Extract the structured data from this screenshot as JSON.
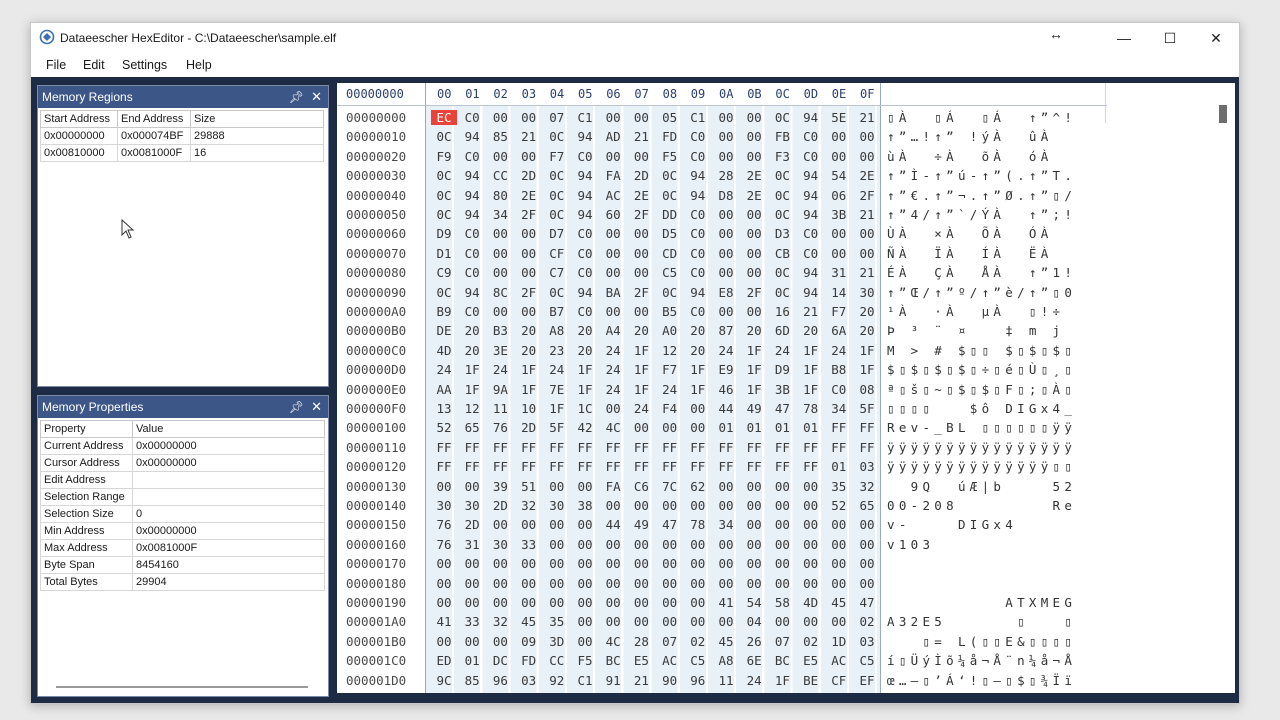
{
  "window": {
    "title": "Dataeescher HexEditor - C:\\Dataeescher\\sample.elf",
    "minimize": "—",
    "maximize": "☐",
    "close": "✕",
    "resize_cursor": "↔"
  },
  "menu": [
    "File",
    "Edit",
    "Settings",
    "Help"
  ],
  "memory_regions": {
    "title": "Memory Regions",
    "columns": [
      "Start Address",
      "End Address",
      "Size"
    ],
    "rows": [
      [
        "0x00000000",
        "0x000074BF",
        "29888"
      ],
      [
        "0x00810000",
        "0x0081000F",
        "16"
      ]
    ]
  },
  "memory_properties": {
    "title": "Memory Properties",
    "columns": [
      "Property",
      "Value"
    ],
    "rows": [
      [
        "Current Address",
        "0x00000000"
      ],
      [
        "Cursor Address",
        "0x00000000"
      ],
      [
        "Edit Address",
        ""
      ],
      [
        "Selection Range",
        ""
      ],
      [
        "Selection Size",
        "0"
      ],
      [
        "Min Address",
        "0x00000000"
      ],
      [
        "Max Address",
        "0x0081000F"
      ],
      [
        "Byte Span",
        "8454160"
      ],
      [
        "Total Bytes",
        "29904"
      ]
    ]
  },
  "hex": {
    "header_addr": "00000000",
    "header_cols": [
      "00",
      "01",
      "02",
      "03",
      "04",
      "05",
      "06",
      "07",
      "08",
      "09",
      "0A",
      "0B",
      "0C",
      "0D",
      "0E",
      "0F"
    ],
    "selected": {
      "row": 0,
      "col": 0
    },
    "rows": [
      {
        "addr": "00000000",
        "bytes": "EC C0 00 00 07 C1 00 00 05 C1 00 00 0C 94 5E 21",
        "ascii": "▯À  ▯Á  ▯Á  ↑”^!"
      },
      {
        "addr": "00000010",
        "bytes": "0C 94 85 21 0C 94 AD 21 FD C0 00 00 FB C0 00 00",
        "ascii": "↑”…!↑” !ýÀ  ûÀ  "
      },
      {
        "addr": "00000020",
        "bytes": "F9 C0 00 00 F7 C0 00 00 F5 C0 00 00 F3 C0 00 00",
        "ascii": "ùÀ  ÷À  õÀ  óÀ  "
      },
      {
        "addr": "00000030",
        "bytes": "0C 94 CC 2D 0C 94 FA 2D 0C 94 28 2E 0C 94 54 2E",
        "ascii": "↑”Ì-↑”ú-↑”(.↑”T."
      },
      {
        "addr": "00000040",
        "bytes": "0C 94 80 2E 0C 94 AC 2E 0C 94 D8 2E 0C 94 06 2F",
        "ascii": "↑”€.↑”¬.↑”Ø.↑”▯/"
      },
      {
        "addr": "00000050",
        "bytes": "0C 94 34 2F 0C 94 60 2F DD C0 00 00 0C 94 3B 21",
        "ascii": "↑”4/↑”`/ÝÀ  ↑”;!"
      },
      {
        "addr": "00000060",
        "bytes": "D9 C0 00 00 D7 C0 00 00 D5 C0 00 00 D3 C0 00 00",
        "ascii": "ÙÀ  ×À  ÕÀ  ÓÀ  "
      },
      {
        "addr": "00000070",
        "bytes": "D1 C0 00 00 CF C0 00 00 CD C0 00 00 CB C0 00 00",
        "ascii": "ÑÀ  ÏÀ  ÍÀ  ËÀ  "
      },
      {
        "addr": "00000080",
        "bytes": "C9 C0 00 00 C7 C0 00 00 C5 C0 00 00 0C 94 31 21",
        "ascii": "ÉÀ  ÇÀ  ÅÀ  ↑”1!"
      },
      {
        "addr": "00000090",
        "bytes": "0C 94 8C 2F 0C 94 BA 2F 0C 94 E8 2F 0C 94 14 30",
        "ascii": "↑”Œ/↑”º/↑”è/↑”▯0"
      },
      {
        "addr": "000000A0",
        "bytes": "B9 C0 00 00 B7 C0 00 00 B5 C0 00 00 16 21 F7 20",
        "ascii": "¹À  ·À  µÀ  ▯!÷ "
      },
      {
        "addr": "000000B0",
        "bytes": "DE 20 B3 20 A8 20 A4 20 A0 20 87 20 6D 20 6A 20",
        "ascii": "Þ ³ ¨ ¤   ‡ m j "
      },
      {
        "addr": "000000C0",
        "bytes": "4D 20 3E 20 23 20 24 1F 12 20 24 1F 24 1F 24 1F",
        "ascii": "M > # $▯▯ $▯$▯$▯"
      },
      {
        "addr": "000000D0",
        "bytes": "24 1F 24 1F 24 1F 24 1F F7 1F E9 1F D9 1F B8 1F",
        "ascii": "$▯$▯$▯$▯÷▯é▯Ù▯¸▯"
      },
      {
        "addr": "000000E0",
        "bytes": "AA 1F 9A 1F 7E 1F 24 1F 24 1F 46 1F 3B 1F C0 08",
        "ascii": "ª▯š▯~▯$▯$▯F▯;▯À▯"
      },
      {
        "addr": "000000F0",
        "bytes": "13 12 11 10 1F 1C 00 24 F4 00 44 49 47 78 34 5F",
        "ascii": "▯▯▯▯   $ô DIGx4_"
      },
      {
        "addr": "00000100",
        "bytes": "52 65 76 2D 5F 42 4C 00 00 00 01 01 01 01 FF FF",
        "ascii": "Rev-_BL ▯▯▯▯▯▯ÿÿ"
      },
      {
        "addr": "00000110",
        "bytes": "FF FF FF FF FF FF FF FF FF FF FF FF FF FF FF FF",
        "ascii": "ÿÿÿÿÿÿÿÿÿÿÿÿÿÿÿÿ"
      },
      {
        "addr": "00000120",
        "bytes": "FF FF FF FF FF FF FF FF FF FF FF FF FF FF 01 03",
        "ascii": "ÿÿÿÿÿÿÿÿÿÿÿÿÿÿ▯▯"
      },
      {
        "addr": "00000130",
        "bytes": "00 00 39 51 00 00 FA C6 7C 62 00 00 00 00 35 32",
        "ascii": "  9Q  úÆ|b    52"
      },
      {
        "addr": "00000140",
        "bytes": "30 30 2D 32 30 38 00 00 00 00 00 00 00 00 52 65",
        "ascii": "00-208        Re"
      },
      {
        "addr": "00000150",
        "bytes": "76 2D 00 00 00 00 44 49 47 78 34 00 00 00 00 00",
        "ascii": "v-    DIGx4     "
      },
      {
        "addr": "00000160",
        "bytes": "76 31 30 33 00 00 00 00 00 00 00 00 00 00 00 00",
        "ascii": "v103            "
      },
      {
        "addr": "00000170",
        "bytes": "00 00 00 00 00 00 00 00 00 00 00 00 00 00 00 00",
        "ascii": "                "
      },
      {
        "addr": "00000180",
        "bytes": "00 00 00 00 00 00 00 00 00 00 00 00 00 00 00 00",
        "ascii": "                "
      },
      {
        "addr": "00000190",
        "bytes": "00 00 00 00 00 00 00 00 00 00 41 54 58 4D 45 47",
        "ascii": "          ATXMEG"
      },
      {
        "addr": "000001A0",
        "bytes": "41 33 32 45 35 00 00 00 00 00 00 04 00 00 00 02",
        "ascii": "A32E5      ▯   ▯"
      },
      {
        "addr": "000001B0",
        "bytes": "00 00 00 09 3D 00 4C 28 07 02 45 26 07 02 1D 03",
        "ascii": "   ▯= L(▯▯E&▯▯▯▯"
      },
      {
        "addr": "000001C0",
        "bytes": "ED 01 DC FD CC F5 BC E5 AC C5 A8 6E BC E5 AC C5",
        "ascii": "í▯ÜýÌõ¼å¬Å¨n¼å¬Å"
      },
      {
        "addr": "000001D0",
        "bytes": "9C 85 96 03 92 C1 91 21 90 96 11 24 1F BE CF EF",
        "ascii": "œ…–▯’Á‘!▯–▯$▯¾Ïï"
      }
    ]
  }
}
